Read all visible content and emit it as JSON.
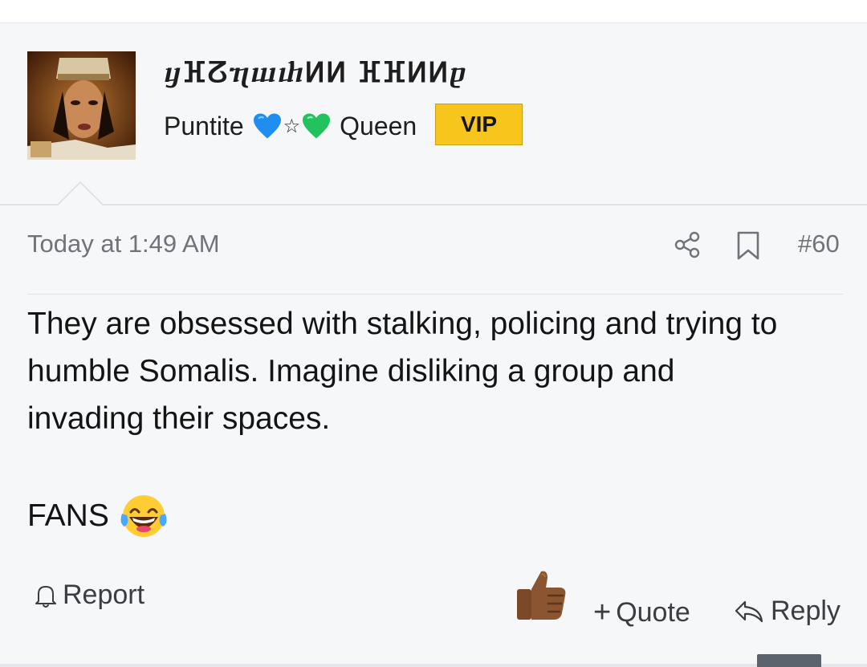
{
  "user": {
    "name": "ⴘⴼⵒⴄⴍⴐⵍⵍ ⴼⴼⵍⵍⴒ",
    "title_prefix": "Puntite",
    "title_suffix": "Queen",
    "title_decorations": [
      "blue-heart-icon",
      "star-icon",
      "green-heart-icon"
    ],
    "badge": "VIP",
    "badge_color": "#f7c51c"
  },
  "post": {
    "timestamp": "Today at 1:49 AM",
    "number": "#60",
    "body_lines": [
      "They are obsessed with stalking, policing and trying to",
      "humble Somalis. Imagine disliking a group and",
      "invading their spaces."
    ],
    "footer_text": "FANS",
    "footer_emoji": "laughing-tears-emoji"
  },
  "actions": {
    "report": "Report",
    "quote": "Quote",
    "reply": "Reply",
    "reaction_icon": "thumbs-up-icon"
  }
}
